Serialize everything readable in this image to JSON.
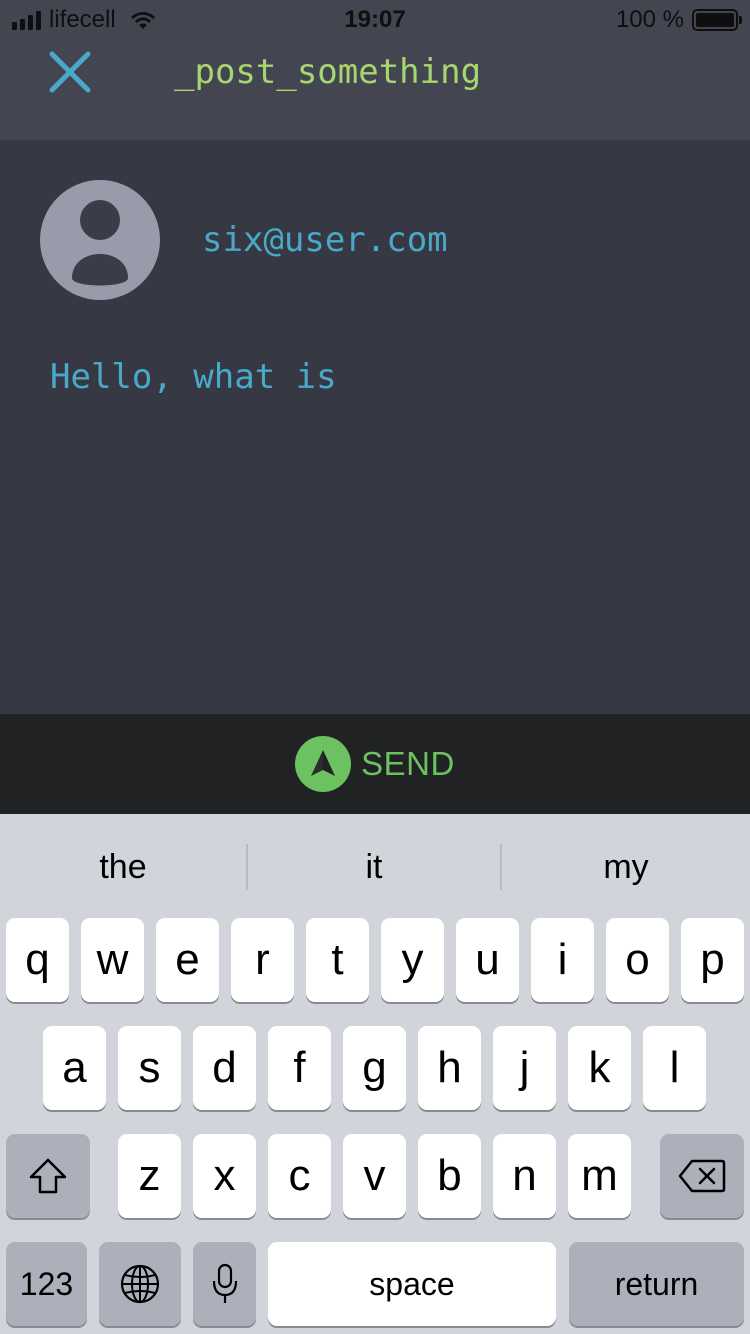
{
  "status_bar": {
    "carrier": "lifecell",
    "time": "19:07",
    "battery": "100 %"
  },
  "header": {
    "title": "_post_something",
    "close_icon": "close-icon"
  },
  "compose": {
    "user_email": "six@user.com",
    "avatar_icon": "user-avatar-icon",
    "text": "Hello, what is"
  },
  "send": {
    "label": "SEND",
    "icon": "send-arrow-icon"
  },
  "keyboard": {
    "suggestions": [
      "the",
      "it",
      "my"
    ],
    "row1": [
      "q",
      "w",
      "e",
      "r",
      "t",
      "y",
      "u",
      "i",
      "o",
      "p"
    ],
    "row2": [
      "a",
      "s",
      "d",
      "f",
      "g",
      "h",
      "j",
      "k",
      "l"
    ],
    "row3": [
      "z",
      "x",
      "c",
      "v",
      "b",
      "n",
      "m"
    ],
    "numbers_label": "123",
    "space_label": "space",
    "return_label": "return"
  },
  "colors": {
    "accent_green": "#a7d670",
    "send_green": "#6cc160",
    "text_blue": "#4aa9c9",
    "header_bg": "#434651",
    "body_bg": "#363944"
  }
}
